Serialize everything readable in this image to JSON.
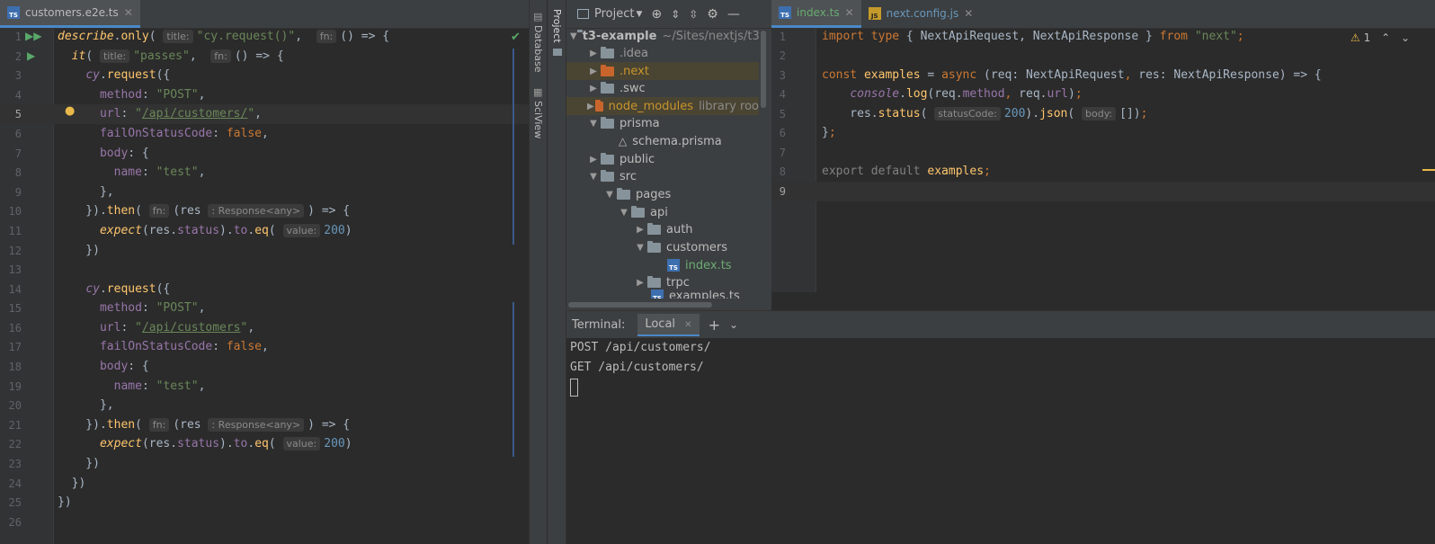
{
  "left_tabs": [
    {
      "label": "customers.e2e.ts",
      "icon": "typescript-file-icon"
    }
  ],
  "right_tabs": [
    {
      "label": "index.ts",
      "icon": "typescript-file-icon"
    },
    {
      "label": "next.config.js",
      "icon": "javascript-file-icon"
    }
  ],
  "left_editor": {
    "current_line": 5,
    "line_numbers": [
      "1",
      "2",
      "3",
      "4",
      "5",
      "6",
      "7",
      "8",
      "9",
      "10",
      "11",
      "12",
      "13",
      "14",
      "15",
      "16",
      "17",
      "18",
      "19",
      "20",
      "21",
      "22",
      "23",
      "24",
      "25",
      "26"
    ]
  },
  "tool_strip": {
    "database_label": "Database",
    "sciview_label": "SciView",
    "project_label": "Project"
  },
  "project": {
    "header_label": "Project",
    "root_name": "t3-example",
    "root_path": "~/Sites/nextjs/t3",
    "items": [
      {
        "label": ".idea"
      },
      {
        "label": ".next"
      },
      {
        "label": ".swc"
      },
      {
        "label": "node_modules",
        "suffix": "library roo"
      },
      {
        "label": "prisma"
      },
      {
        "label": "schema.prisma"
      },
      {
        "label": "public"
      },
      {
        "label": "src"
      },
      {
        "label": "pages"
      },
      {
        "label": "api"
      },
      {
        "label": "auth"
      },
      {
        "label": "customers"
      },
      {
        "label": "index.ts"
      },
      {
        "label": "trpc"
      },
      {
        "label": "examples.ts"
      }
    ]
  },
  "right_editor": {
    "warning_count": "1",
    "line_numbers": [
      "1",
      "2",
      "3",
      "4",
      "5",
      "6",
      "7",
      "8",
      "9"
    ]
  },
  "terminal": {
    "title": "Terminal:",
    "tab_label": "Local",
    "lines": [
      "POST /api/customers/",
      "GET /api/customers/"
    ]
  }
}
